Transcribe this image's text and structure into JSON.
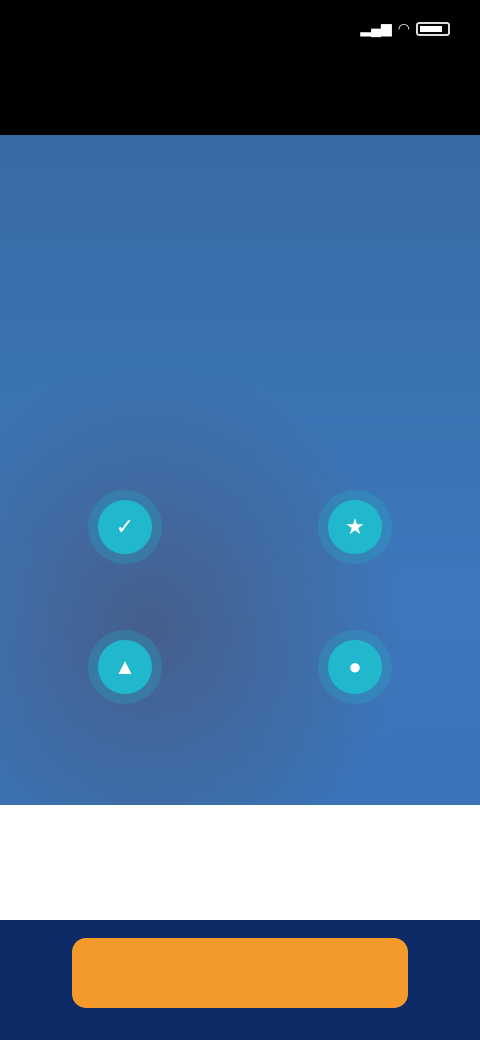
{
  "status_bar": {
    "time": "",
    "icons": [
      "signal-icon",
      "wifi-icon",
      "battery-icon"
    ]
  },
  "topbar": {
    "skip_label": ""
  },
  "onboarding": {
    "headline": "",
    "subtext": "",
    "features": [
      {
        "icon": "feature-icon-1",
        "label": ""
      },
      {
        "icon": "feature-icon-2",
        "label": ""
      },
      {
        "icon": "feature-icon-3",
        "label": ""
      },
      {
        "icon": "feature-icon-4",
        "label": ""
      }
    ]
  },
  "strip": {
    "label": ""
  },
  "cta": {
    "label": ""
  },
  "colors": {
    "hero_blue": "#3a6aa6",
    "accent_teal": "#21b7cc",
    "cta_orange": "#f39a2a",
    "footer_navy": "#0e2a66"
  }
}
